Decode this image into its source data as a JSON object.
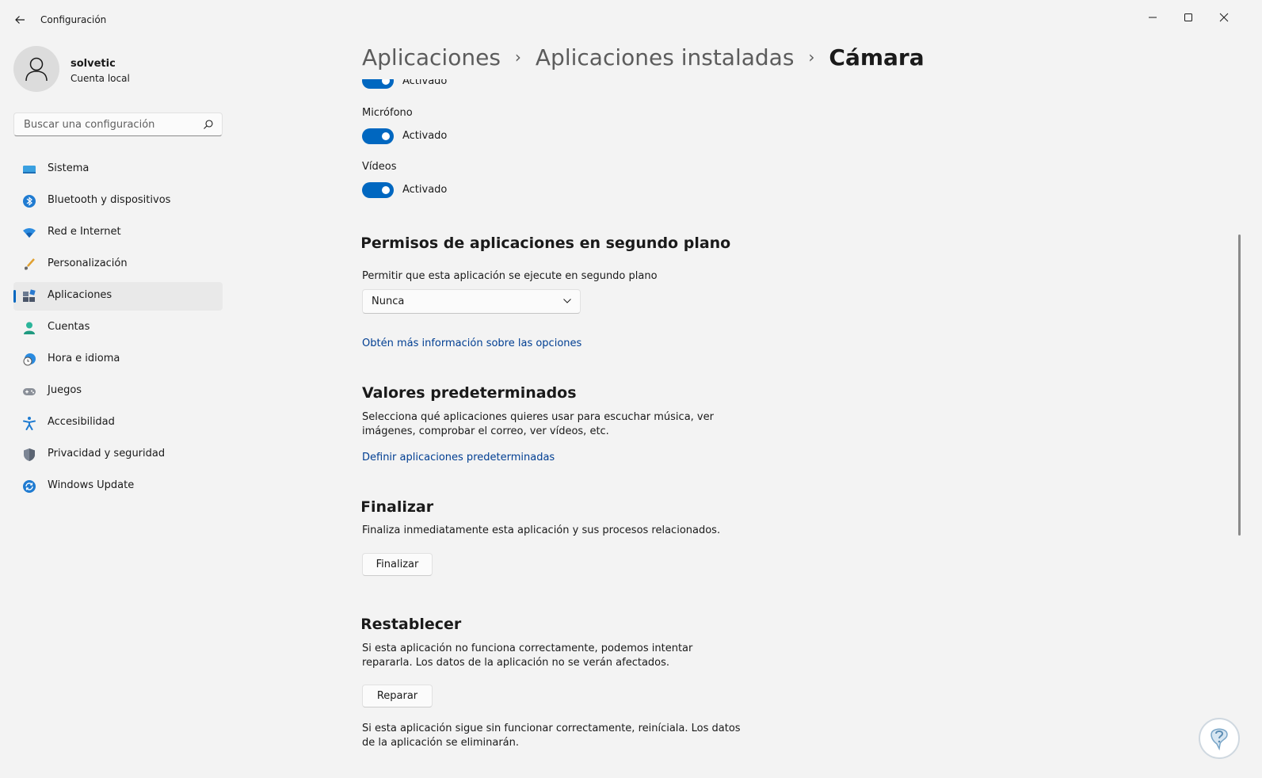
{
  "window": {
    "title": "Configuración"
  },
  "user": {
    "name": "solvetic",
    "account_type": "Cuenta local"
  },
  "search": {
    "placeholder": "Buscar una configuración"
  },
  "sidebar": {
    "items": [
      {
        "label": "Sistema",
        "icon": "monitor-icon"
      },
      {
        "label": "Bluetooth y dispositivos",
        "icon": "bluetooth-icon"
      },
      {
        "label": "Red e Internet",
        "icon": "wifi-icon"
      },
      {
        "label": "Personalización",
        "icon": "brush-icon"
      },
      {
        "label": "Aplicaciones",
        "icon": "apps-icon",
        "active": true
      },
      {
        "label": "Cuentas",
        "icon": "person-icon"
      },
      {
        "label": "Hora e idioma",
        "icon": "clock-globe-icon"
      },
      {
        "label": "Juegos",
        "icon": "gamepad-icon"
      },
      {
        "label": "Accesibilidad",
        "icon": "accessibility-icon"
      },
      {
        "label": "Privacidad y seguridad",
        "icon": "shield-icon"
      },
      {
        "label": "Windows Update",
        "icon": "update-icon"
      }
    ]
  },
  "breadcrumb": {
    "items": [
      "Aplicaciones",
      "Aplicaciones instaladas"
    ],
    "current": "Cámara"
  },
  "permissions": {
    "partial_status": "Activado",
    "microphone": {
      "label": "Micrófono",
      "status": "Activado"
    },
    "videos": {
      "label": "Vídeos",
      "status": "Activado"
    }
  },
  "background": {
    "title": "Permisos de aplicaciones en segundo plano",
    "prompt": "Permitir que esta aplicación se ejecute en segundo plano",
    "selected": "Nunca",
    "link": "Obtén más información sobre las opciones"
  },
  "defaults": {
    "title": "Valores predeterminados",
    "description_line1": "Selecciona qué aplicaciones quieres usar para escuchar música, ver",
    "description_line2": "imágenes, comprobar el correo, ver vídeos, etc.",
    "link": "Definir aplicaciones predeterminadas"
  },
  "terminate": {
    "title": "Finalizar",
    "description": "Finaliza inmediatamente esta aplicación y sus procesos relacionados.",
    "button": "Finalizar"
  },
  "reset": {
    "title": "Restablecer",
    "description_line1": "Si esta aplicación no funciona correctamente, podemos intentar",
    "description_line2": "repararla. Los datos de la aplicación no se verán afectados.",
    "button": "Reparar",
    "note_line1": "Si esta aplicación sigue sin funcionar correctamente, reiníciala. Los datos",
    "note_line2": "de la aplicación se eliminarán."
  },
  "colors": {
    "accent": "#0067c0",
    "link": "#003e92",
    "background": "#f3f3f3"
  }
}
